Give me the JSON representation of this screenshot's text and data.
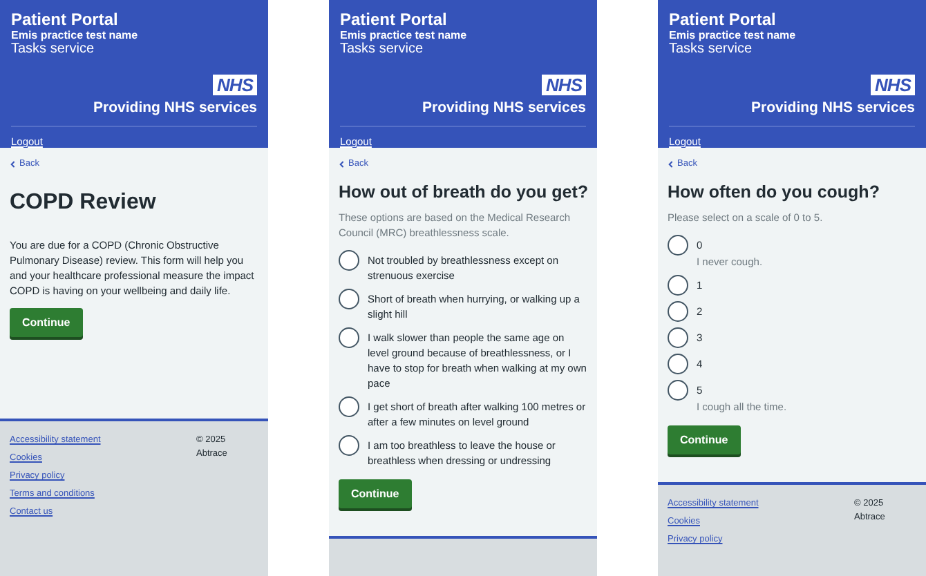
{
  "screens": [
    {
      "header": {
        "title": "Patient Portal",
        "practice": "Emis practice test name",
        "service": "Tasks service",
        "logo": "NHS",
        "tagline": "Providing NHS services",
        "logout": "Logout"
      },
      "back": "Back",
      "heading": "COPD Review",
      "intro": {
        "kind": "body",
        "text": "You are due for a COPD (Chronic Obstructive Pulmonary Disease) review. This form will help you and your healthcare professional measure the impact COPD is having on your wellbeing and daily life."
      },
      "button": "Continue",
      "footer": {
        "links": [
          "Accessibility statement",
          "Cookies",
          "Privacy policy",
          "Terms and conditions",
          "Contact us"
        ],
        "copyright": [
          "© 2025",
          "Abtrace"
        ]
      }
    },
    {
      "header": {
        "title": "Patient Portal",
        "practice": "Emis practice test name",
        "service": "Tasks service",
        "logo": "NHS",
        "tagline": "Providing NHS services",
        "logout": "Logout"
      },
      "back": "Back",
      "heading": "How out of breath do you get?",
      "intro": {
        "kind": "hint",
        "text": "These options are based on the Medical Research Council (MRC) breathlessness scale."
      },
      "options": [
        {
          "label": "Not troubled by breathlessness except on strenuous exercise",
          "selected": false
        },
        {
          "label": "Short of breath when hurrying, or walking up a slight hill",
          "selected": false
        },
        {
          "label": "I walk slower than people the same age on level ground because of breathlessness, or I have to stop for breath when walking at my own pace",
          "selected": false
        },
        {
          "label": "I get short of breath after walking 100 metres or after a few minutes on level ground",
          "selected": false
        },
        {
          "label": "I am too breathless to leave the house or breathless when dressing or undressing",
          "selected": false
        }
      ],
      "button": "Continue"
    },
    {
      "header": {
        "title": "Patient Portal",
        "practice": "Emis practice test name",
        "service": "Tasks service",
        "logo": "NHS",
        "tagline": "Providing NHS services",
        "logout": "Logout"
      },
      "back": "Back",
      "heading": "How often do you cough?",
      "intro": {
        "kind": "hint",
        "text": "Please select on a scale of 0 to 5."
      },
      "options": [
        {
          "label": "0",
          "hint": "I never cough.",
          "selected": false
        },
        {
          "label": "1",
          "selected": false
        },
        {
          "label": "2",
          "selected": false
        },
        {
          "label": "3",
          "selected": false
        },
        {
          "label": "4",
          "selected": false
        },
        {
          "label": "5",
          "hint": "I cough all the time.",
          "selected": false
        }
      ],
      "button": "Continue",
      "footer": {
        "links": [
          "Accessibility statement",
          "Cookies",
          "Privacy policy"
        ],
        "copyright": [
          "© 2025",
          "Abtrace"
        ]
      }
    }
  ]
}
